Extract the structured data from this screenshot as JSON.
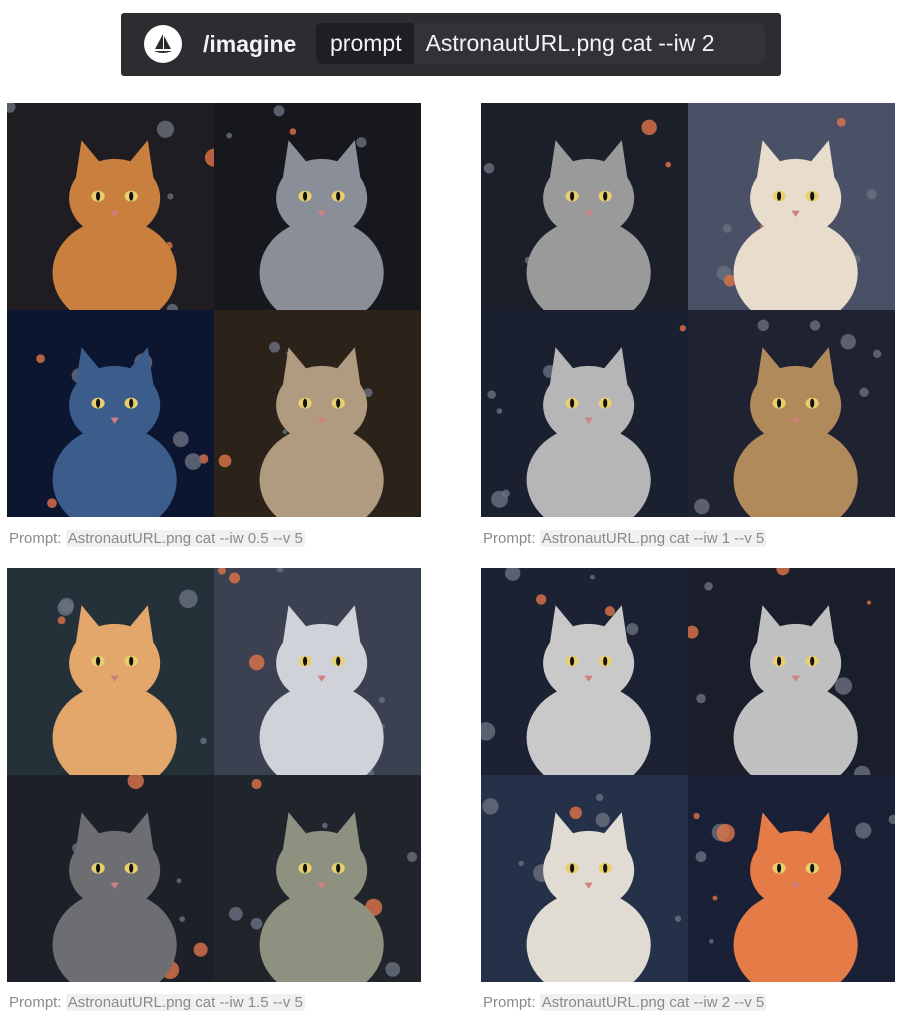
{
  "command_bar": {
    "command": "/imagine",
    "option_name": "prompt",
    "option_value": "AstronautURL.png cat --iw 2",
    "icon": "sailboat-icon"
  },
  "results": [
    {
      "caption_label": "Prompt:",
      "caption_prompt": "AstronautURL.png cat --iw 0.5 --v 5",
      "palette": [
        "#c9803f",
        "#8a8e98",
        "#3c5c8c",
        "#b09a80"
      ],
      "backgrounds": [
        "#1f1d22",
        "#16181e",
        "#0d1630",
        "#2b2319"
      ]
    },
    {
      "caption_label": "Prompt:",
      "caption_prompt": "AstronautURL.png cat --iw 1 --v 5",
      "palette": [
        "#9a9a9a",
        "#e8dccc",
        "#b6b6b6",
        "#b08a5a"
      ],
      "backgrounds": [
        "#1b1f2a",
        "#4a5065",
        "#1a2030",
        "#1f2230"
      ]
    },
    {
      "caption_label": "Prompt:",
      "caption_prompt": "AstronautURL.png cat --iw 1.5 --v 5",
      "palette": [
        "#e3a66b",
        "#cfd2d8",
        "#6c6e72",
        "#8e9080"
      ],
      "backgrounds": [
        "#243139",
        "#3b4150",
        "#1d2028",
        "#20242b"
      ]
    },
    {
      "caption_label": "Prompt:",
      "caption_prompt": "AstronautURL.png cat --iw 2 --v 5",
      "palette": [
        "#c9c9c9",
        "#c0c0c0",
        "#e0dcd4",
        "#e57c48"
      ],
      "backgrounds": [
        "#1c2233",
        "#1a1e2b",
        "#253049",
        "#1a2036"
      ]
    }
  ]
}
